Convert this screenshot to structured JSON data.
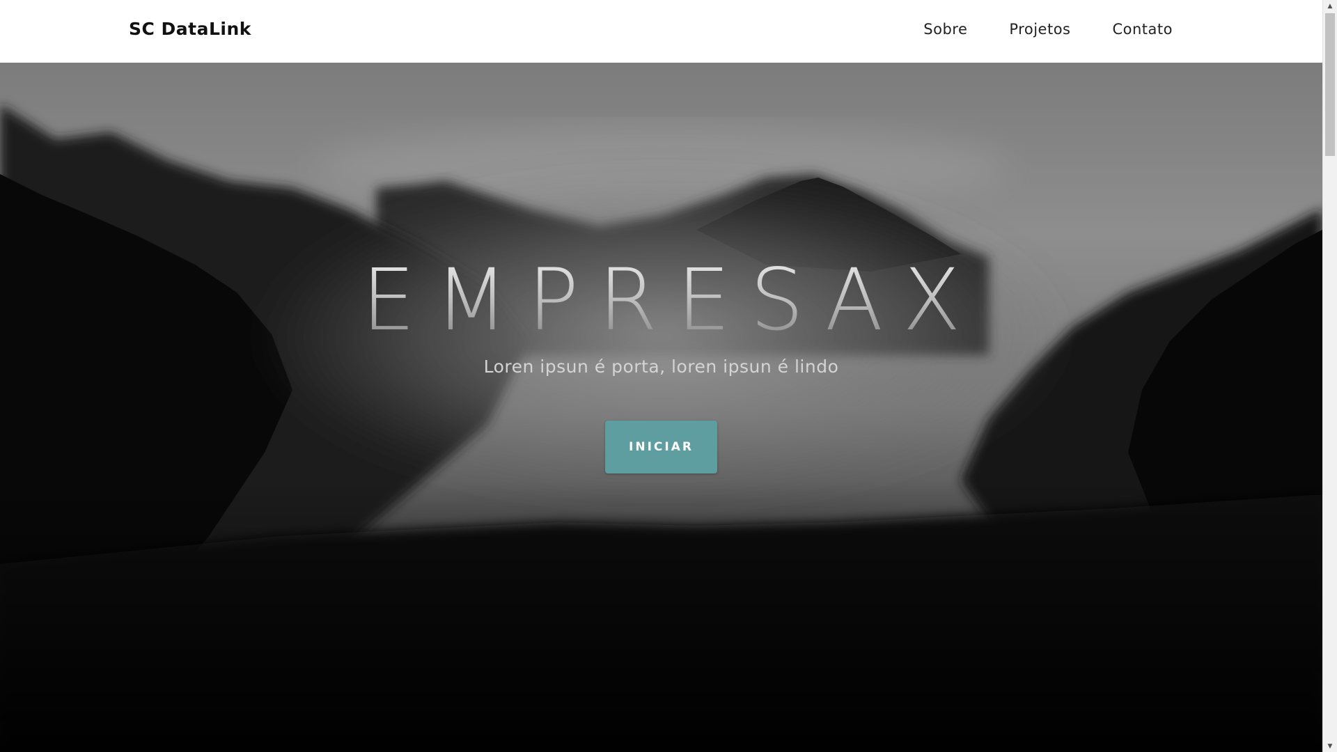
{
  "navbar": {
    "brand": "SC DataLink",
    "links": [
      {
        "label": "Sobre"
      },
      {
        "label": "Projetos"
      },
      {
        "label": "Contato"
      }
    ]
  },
  "hero": {
    "title": "EMPRESAX",
    "subtitle": "Loren ipsun é porta, loren ipsun é lindo",
    "button_label": "INICIAR",
    "button_color": "#5f9ea0",
    "background_image": "misty-forest-mountains-grayscale"
  },
  "scrollbar": {
    "up_icon": "chevron-up-icon",
    "down_icon": "chevron-down-icon"
  }
}
